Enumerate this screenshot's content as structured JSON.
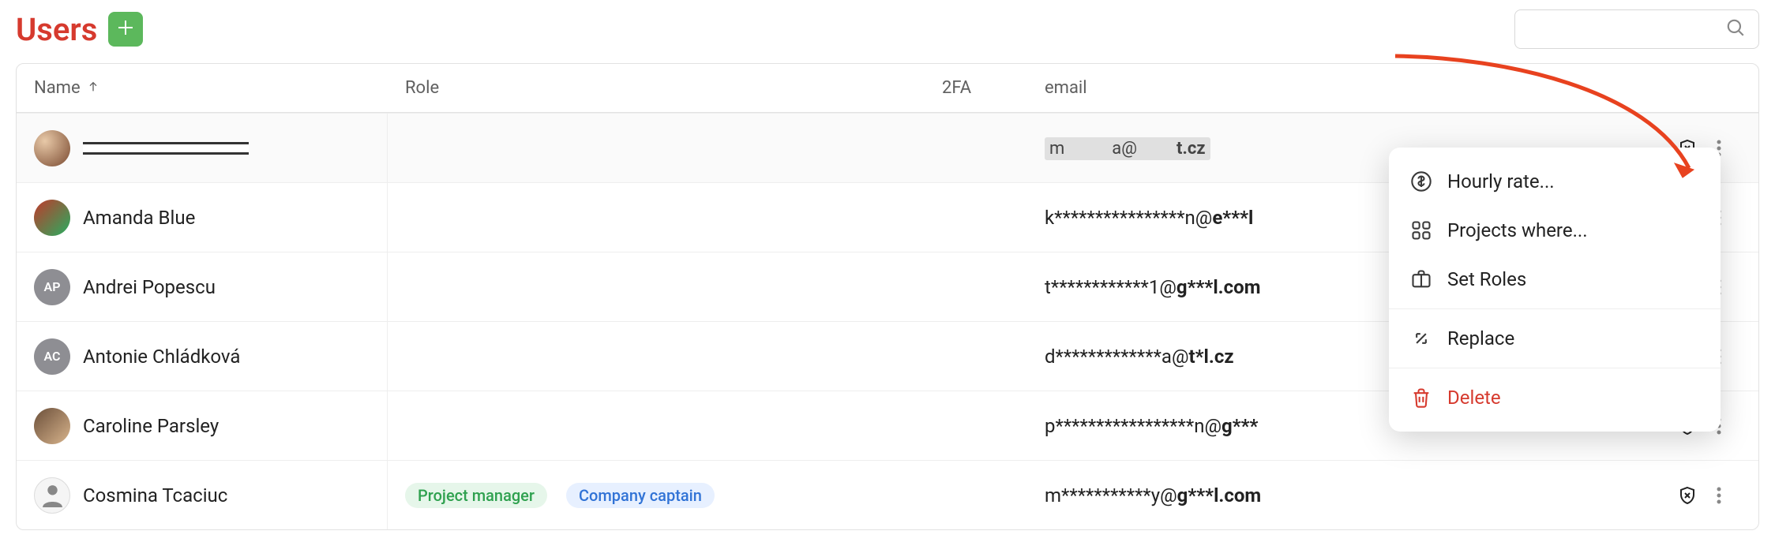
{
  "header": {
    "title": "Users"
  },
  "search": {
    "placeholder": ""
  },
  "columns": {
    "name": "Name",
    "role": "Role",
    "twofa": "2FA",
    "email": "email"
  },
  "context_menu": {
    "hourly_rate": "Hourly rate...",
    "projects_where": "Projects where...",
    "set_roles": "Set Roles",
    "replace": "Replace",
    "delete": "Delete"
  },
  "rows": [
    {
      "name": "",
      "avatar_type": "photo1",
      "initials": "",
      "email_prefix": "m",
      "email_mid": "a@",
      "email_bold": "t.cz",
      "redacted": true
    },
    {
      "name": "Amanda Blue",
      "avatar_type": "photo2",
      "initials": "",
      "email_prefix": "k****************n@",
      "email_bold": "e***l"
    },
    {
      "name": "Andrei Popescu",
      "avatar_type": "initials-ap",
      "initials": "AP",
      "email_prefix": "t************1@",
      "email_bold": "g***l.com"
    },
    {
      "name": "Antonie Chládková",
      "avatar_type": "initials-ac",
      "initials": "AC",
      "email_prefix": "d*************a@",
      "email_bold": "t*l.cz"
    },
    {
      "name": "Caroline Parsley",
      "avatar_type": "photo3",
      "initials": "",
      "email_prefix": "p*****************n@",
      "email_bold": "g***"
    },
    {
      "name": "Cosmina Tcaciuc",
      "avatar_type": "photo4",
      "initials": "",
      "email_prefix": "m***********y@",
      "email_bold": "g***l.com",
      "roles": [
        {
          "label": "Project manager",
          "cls": "green"
        },
        {
          "label": "Company captain",
          "cls": "blue"
        }
      ]
    }
  ]
}
